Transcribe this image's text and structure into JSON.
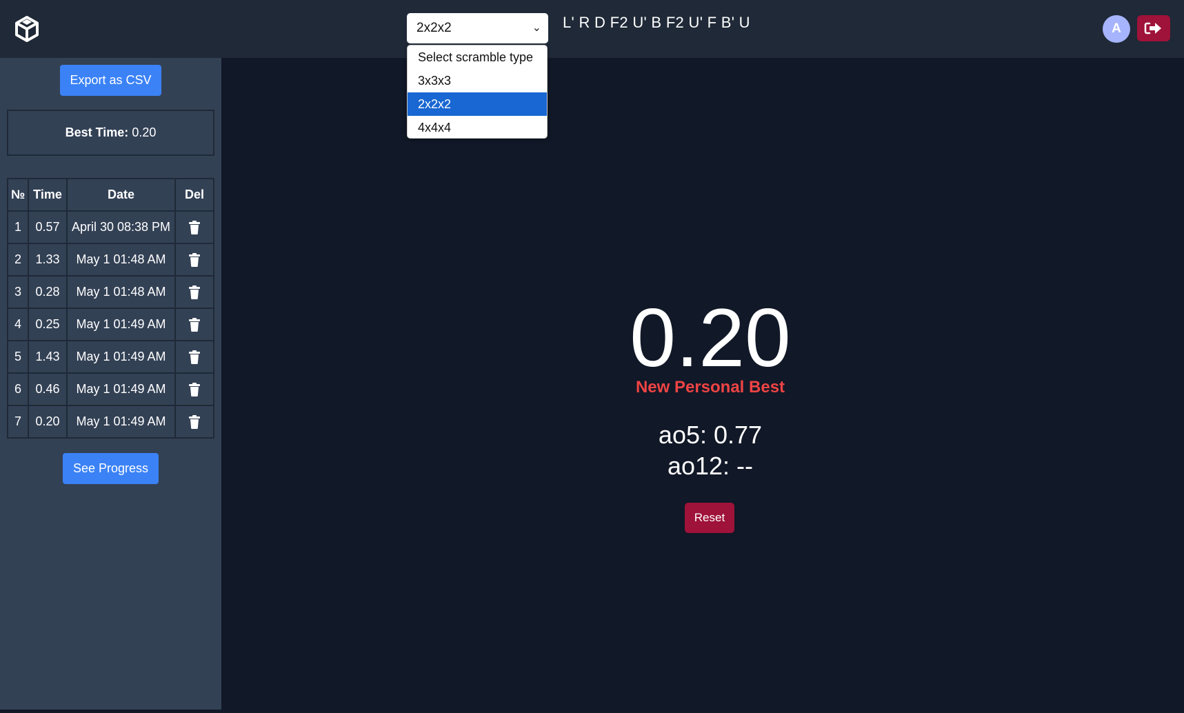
{
  "header": {
    "logo_icon": "cube-logo-icon",
    "scramble_select": {
      "selected": "2x2x2"
    },
    "scramble": "L' R D F2 U' B F2 U' F B' U",
    "avatar_initial": "A",
    "logout_icon": "sign-out-icon"
  },
  "dropdown": {
    "options": [
      "Select scramble type",
      "3x3x3",
      "2x2x2",
      "4x4x4"
    ],
    "highlighted": "2x2x2"
  },
  "sidebar": {
    "export_label": "Export as CSV",
    "best_label": "Best Time:",
    "best_value": "0.20",
    "table": {
      "headers": [
        "№",
        "Time",
        "Date",
        "Del"
      ],
      "rows": [
        {
          "no": "1",
          "time": "0.57",
          "date": "April 30 08:38 PM"
        },
        {
          "no": "2",
          "time": "1.33",
          "date": "May 1 01:48 AM"
        },
        {
          "no": "3",
          "time": "0.28",
          "date": "May 1 01:48 AM"
        },
        {
          "no": "4",
          "time": "0.25",
          "date": "May 1 01:49 AM"
        },
        {
          "no": "5",
          "time": "1.43",
          "date": "May 1 01:49 AM"
        },
        {
          "no": "6",
          "time": "0.46",
          "date": "May 1 01:49 AM"
        },
        {
          "no": "7",
          "time": "0.20",
          "date": "May 1 01:49 AM"
        }
      ]
    },
    "progress_label": "See Progress"
  },
  "main": {
    "timer": "0.20",
    "personal_best": "New Personal Best",
    "ao5": "ao5: 0.77",
    "ao12": "ao12: --",
    "reset_label": "Reset"
  },
  "colors": {
    "background": "#111827",
    "header": "#1f2937",
    "sidebar": "#334155",
    "primary": "#3b82f6",
    "danger": "#9f1239",
    "pb_text": "#ef4444"
  }
}
